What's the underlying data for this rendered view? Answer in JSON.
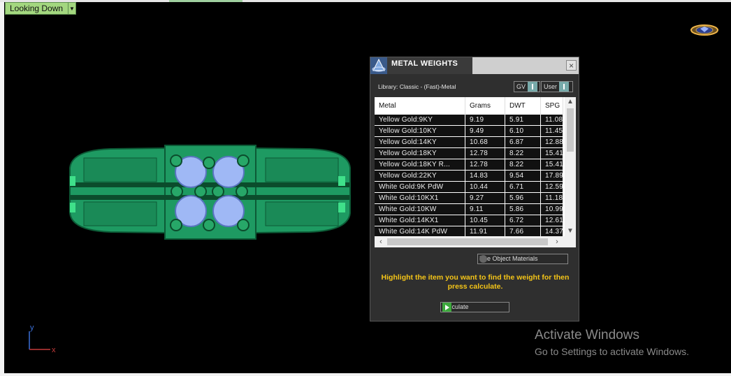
{
  "viewport": {
    "view_label": "Looking Down",
    "axis_x": "x",
    "axis_y": "y",
    "ring_color": "#1a8f5a",
    "gem_color": "#9fb8f5"
  },
  "panel": {
    "title": "METAL WEIGHTS",
    "close": "×",
    "library": "Library: Classic - (Fast)-Metal",
    "toggle_gv": "GV",
    "toggle_user": "User",
    "columns": [
      "Metal",
      "Grams",
      "DWT",
      "SPG"
    ],
    "rows": [
      [
        "Yellow Gold:9KY",
        "9.19",
        "5.91",
        "11.08"
      ],
      [
        "Yellow Gold:10KY",
        "9.49",
        "6.10",
        "11.45"
      ],
      [
        "Yellow Gold:14KY",
        "10.68",
        "6.87",
        "12.88"
      ],
      [
        "Yellow Gold:18KY",
        "12.78",
        "8.22",
        "15.41"
      ],
      [
        "Yellow Gold:18KY R...",
        "12.78",
        "8.22",
        "15.41"
      ],
      [
        "Yellow Gold:22KY",
        "14.83",
        "9.54",
        "17.89"
      ],
      [
        "White Gold:9K PdW",
        "10.44",
        "6.71",
        "12.59"
      ],
      [
        "White Gold:10KX1",
        "9.27",
        "5.96",
        "11.18"
      ],
      [
        "White Gold:10KW",
        "9.11",
        "5.86",
        "10.99"
      ],
      [
        "White Gold:14KX1",
        "10.45",
        "6.72",
        "12.61"
      ],
      [
        "White Gold:14K PdW",
        "11.91",
        "7.66",
        "14.37"
      ]
    ],
    "use_object_materials": "Use Object Materials",
    "hint": "Highlight the item you want to find the weight for then press calculate.",
    "calculate": "Calculate",
    "hint_color": "#f5c518"
  },
  "watermark": {
    "line1": "Activate Windows",
    "line2": "Go to Settings to activate Windows."
  }
}
